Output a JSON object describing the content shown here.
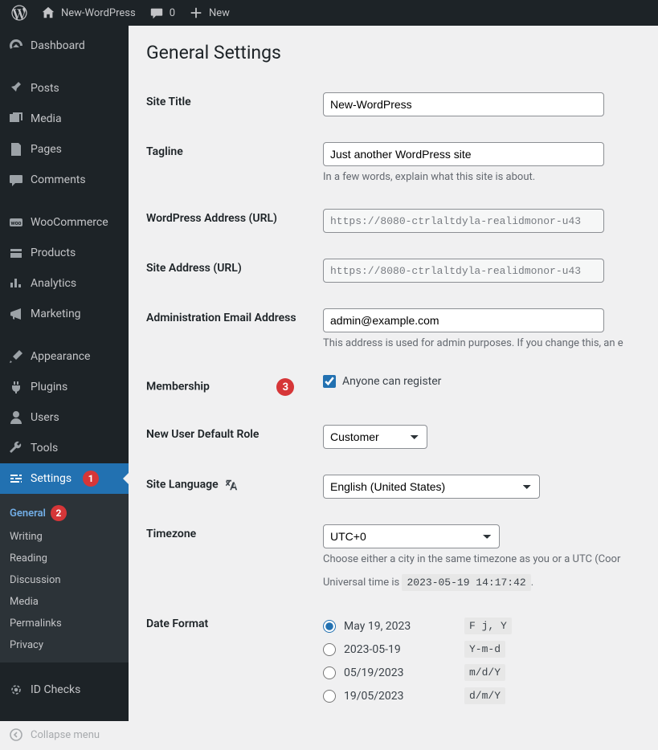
{
  "adminBar": {
    "siteName": "New-WordPress",
    "commentsCount": "0",
    "newLabel": "New"
  },
  "sidebar": {
    "dashboard": "Dashboard",
    "posts": "Posts",
    "media": "Media",
    "pages": "Pages",
    "comments": "Comments",
    "woocommerce": "WooCommerce",
    "products": "Products",
    "analytics": "Analytics",
    "marketing": "Marketing",
    "appearance": "Appearance",
    "plugins": "Plugins",
    "users": "Users",
    "tools": "Tools",
    "settings": "Settings",
    "idChecks": "ID Checks",
    "collapse": "Collapse menu",
    "submenu": {
      "general": "General",
      "writing": "Writing",
      "reading": "Reading",
      "discussion": "Discussion",
      "media": "Media",
      "permalinks": "Permalinks",
      "privacy": "Privacy"
    }
  },
  "annotations": {
    "one": "1",
    "two": "2",
    "three": "3"
  },
  "page": {
    "title": "General Settings",
    "labels": {
      "siteTitle": "Site Title",
      "tagline": "Tagline",
      "wpAddress": "WordPress Address (URL)",
      "siteAddress": "Site Address (URL)",
      "adminEmail": "Administration Email Address",
      "membership": "Membership",
      "newUserRole": "New User Default Role",
      "siteLanguage": "Site Language",
      "timezone": "Timezone",
      "dateFormat": "Date Format"
    },
    "values": {
      "siteTitle": "New-WordPress",
      "tagline": "Just another WordPress site",
      "wpAddress": "https://8080-ctrlaltdyla-realidmonor-u43",
      "siteAddress": "https://8080-ctrlaltdyla-realidmonor-u43",
      "adminEmail": "admin@example.com",
      "membershipCheckbox": "Anyone can register",
      "newUserRole": "Customer",
      "siteLanguage": "English (United States)",
      "timezone": "UTC+0",
      "universalTime": "2023-05-19 14:17:42"
    },
    "descriptions": {
      "tagline": "In a few words, explain what this site is about.",
      "adminEmail": "This address is used for admin purposes. If you change this, an e",
      "timezone": "Choose either a city in the same timezone as you or a UTC (Coor",
      "universalPrefix": "Universal time is ",
      "universalSuffix": "."
    },
    "dateFormats": [
      {
        "label": "May 19, 2023",
        "code": "F j, Y",
        "checked": true
      },
      {
        "label": "2023-05-19",
        "code": "Y-m-d",
        "checked": false
      },
      {
        "label": "05/19/2023",
        "code": "m/d/Y",
        "checked": false
      },
      {
        "label": "19/05/2023",
        "code": "d/m/Y",
        "checked": false
      }
    ]
  }
}
